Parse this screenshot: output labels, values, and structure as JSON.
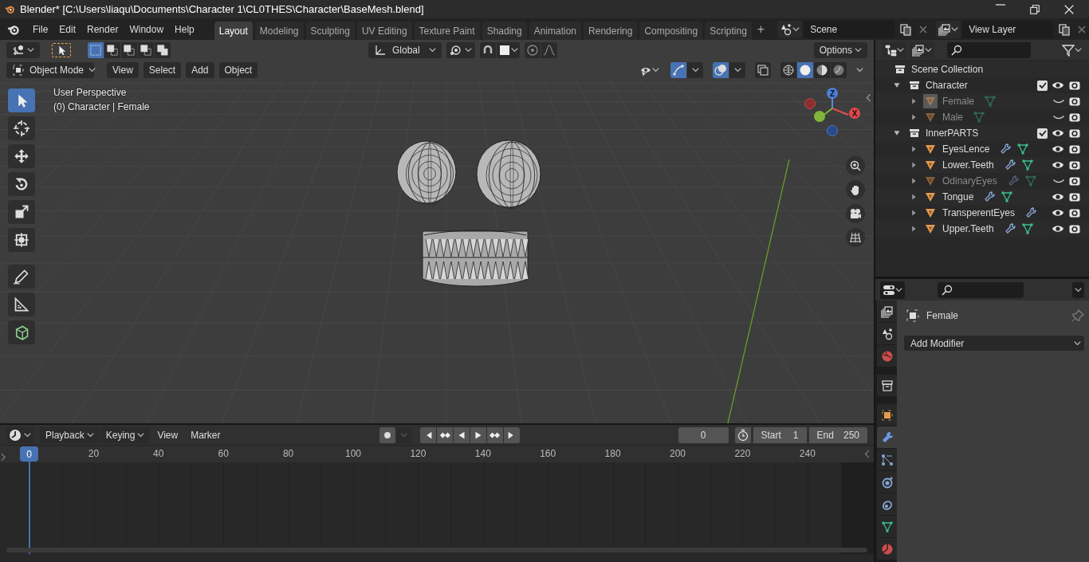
{
  "window": {
    "title": "Blender* [C:\\Users\\liaqu\\Documents\\Character 1\\CL0THES\\Character\\BaseMesh.blend]"
  },
  "menu": [
    "File",
    "Edit",
    "Render",
    "Window",
    "Help"
  ],
  "workspaces": [
    {
      "label": "Layout",
      "selected": true
    },
    {
      "label": "Modeling",
      "selected": false
    },
    {
      "label": "Sculpting",
      "selected": false
    },
    {
      "label": "UV Editing",
      "selected": false
    },
    {
      "label": "Texture Paint",
      "selected": false
    },
    {
      "label": "Shading",
      "selected": false
    },
    {
      "label": "Animation",
      "selected": false
    },
    {
      "label": "Rendering",
      "selected": false
    },
    {
      "label": "Compositing",
      "selected": false
    },
    {
      "label": "Scripting",
      "selected": false
    }
  ],
  "add_workspace": "+",
  "scene": {
    "value": "Scene"
  },
  "view_layer": {
    "value": "View Layer"
  },
  "tool_header": {
    "select_modes": [
      {
        "selected": true
      },
      {
        "selected": false
      },
      {
        "selected": false
      },
      {
        "selected": false
      },
      {
        "selected": false
      }
    ],
    "orientation": "Global",
    "options": "Options"
  },
  "viewport": {
    "mode": "Object Mode",
    "menus": [
      "View",
      "Select",
      "Add",
      "Object"
    ],
    "overlay_lines": [
      "User Perspective",
      "(0) Character | Female"
    ],
    "gizmo": {
      "z": "Z",
      "x": "X"
    },
    "shading": [
      {
        "kind": "wireframe",
        "selected": false
      },
      {
        "kind": "solid",
        "selected": true
      },
      {
        "kind": "material",
        "selected": false
      },
      {
        "kind": "rendered",
        "selected": false
      }
    ],
    "tools": [
      {
        "kind": "select",
        "selected": true
      },
      {
        "kind": "cursor",
        "selected": false
      },
      {
        "kind": "move",
        "selected": false
      },
      {
        "kind": "rotate",
        "selected": false
      },
      {
        "kind": "scale",
        "selected": false
      },
      {
        "kind": "transform",
        "selected": false
      },
      {
        "kind": "annotate",
        "selected": false
      },
      {
        "kind": "measure",
        "selected": false
      },
      {
        "kind": "add_cube",
        "selected": false
      }
    ]
  },
  "outliner": {
    "root": "Scene Collection",
    "collections": [
      {
        "name": "Character",
        "checked": true,
        "expanded": true,
        "children": [
          {
            "name": "Female",
            "selected": true,
            "hidden": true,
            "modifier": false,
            "mesh": true
          },
          {
            "name": "Male",
            "selected": false,
            "hidden": true,
            "modifier": false,
            "mesh": true
          }
        ]
      },
      {
        "name": "InnerPARTS",
        "checked": true,
        "expanded": true,
        "children": [
          {
            "name": "EyesLence",
            "selected": false,
            "hidden": false,
            "modifier": true,
            "mesh": true
          },
          {
            "name": "Lower.Teeth",
            "selected": false,
            "hidden": false,
            "modifier": true,
            "mesh": true
          },
          {
            "name": "OdinaryEyes",
            "selected": false,
            "hidden": true,
            "modifier": true,
            "mesh": true
          },
          {
            "name": "Tongue",
            "selected": false,
            "hidden": false,
            "modifier": true,
            "mesh": true
          },
          {
            "name": "TransperentEyes",
            "selected": false,
            "hidden": false,
            "modifier": true,
            "mesh": false
          },
          {
            "name": "Upper.Teeth",
            "selected": false,
            "hidden": false,
            "modifier": true,
            "mesh": true
          }
        ]
      }
    ]
  },
  "properties": {
    "object_name": "Female",
    "add_modifier": "Add Modifier",
    "tabs": [
      {
        "kind": "view_layer",
        "selected": false
      },
      {
        "kind": "scene",
        "selected": false
      },
      {
        "kind": "world",
        "selected": false
      },
      {
        "kind": "collection",
        "selected": false
      },
      {
        "kind": "object",
        "selected": false
      },
      {
        "kind": "modifiers",
        "selected": true
      },
      {
        "kind": "particles",
        "selected": false
      },
      {
        "kind": "physics",
        "selected": false
      },
      {
        "kind": "constraints",
        "selected": false
      },
      {
        "kind": "data",
        "selected": false
      },
      {
        "kind": "material",
        "selected": false
      }
    ]
  },
  "timeline": {
    "dropdowns": [
      "Playback",
      "Keying"
    ],
    "menus": [
      "View",
      "Marker"
    ],
    "current_frame": "0",
    "start_label": "Start",
    "start": "1",
    "end_label": "End",
    "end": "250",
    "playhead": "0",
    "ruler": [
      "20",
      "40",
      "60",
      "80",
      "100",
      "120",
      "140",
      "160",
      "180",
      "200",
      "220",
      "240"
    ]
  }
}
